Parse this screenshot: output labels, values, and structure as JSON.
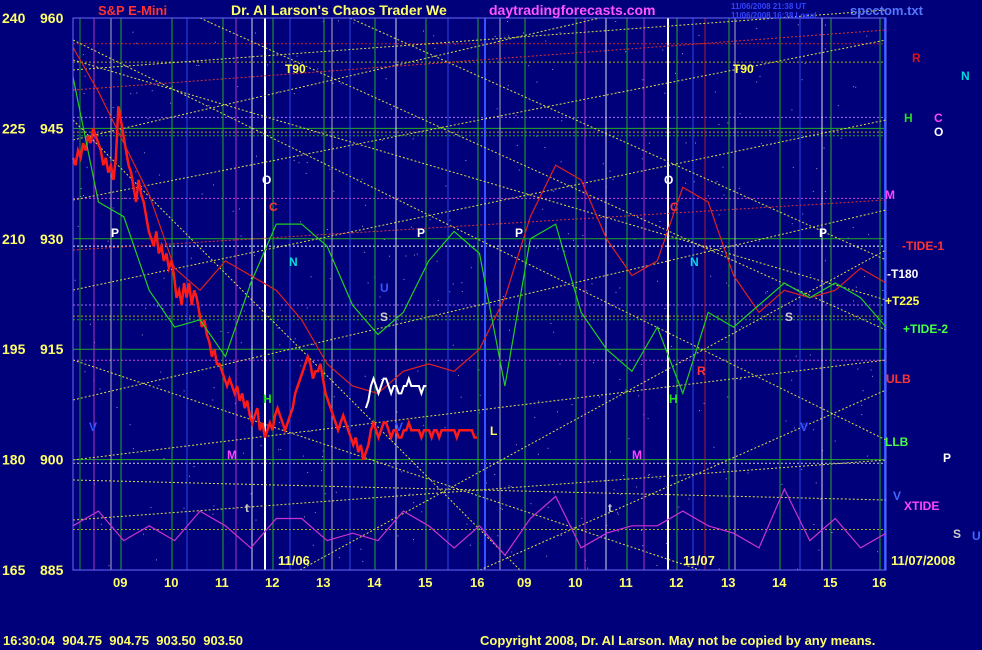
{
  "chart_data": {
    "type": "line",
    "title_left": "S&P E-Mini",
    "title_center": "Dr. Al Larson's Chaos Trader We",
    "title_site": "daytradingforecasts.com",
    "title_file": "spcctom.txt",
    "stamp_line1": "11/06/2008 21:38 UT",
    "stamp_line2": "11/06/2008 16:38 Local",
    "status_bar": "16:30:04  904.75  904.75  903.50  903.50",
    "copyright": "Copyright 2008, Dr. Al Larson. May not be copied by any means.",
    "price_axis": {
      "ticks": [
        885,
        900,
        915,
        930,
        945,
        960
      ],
      "range": [
        885,
        960
      ]
    },
    "secondary_axis": {
      "ticks": [
        165,
        180,
        195,
        210,
        225,
        240
      ],
      "range": [
        165,
        240
      ]
    },
    "x_axis": {
      "tick_labels": [
        "09",
        "10",
        "11",
        "12",
        "13",
        "14",
        "15",
        "16",
        "09",
        "10",
        "11",
        "12",
        "13",
        "14",
        "15",
        "16"
      ],
      "date_labels": [
        "11/06",
        "11/07",
        "11/07/2008"
      ]
    },
    "right_labels": [
      {
        "text": "R",
        "color": "#dd1111"
      },
      {
        "text": "N",
        "color": "#00dddd"
      },
      {
        "text": "H",
        "color": "#22dd22"
      },
      {
        "text": "C",
        "color": "#ff44ff"
      },
      {
        "text": "O",
        "color": "#ffffff"
      },
      {
        "text": "M",
        "color": "#ff44ff"
      },
      {
        "text": "-TIDE-1",
        "color": "#ff3333"
      },
      {
        "text": "-T180",
        "color": "#ffffff"
      },
      {
        "text": "+T225",
        "color": "#ffff44"
      },
      {
        "text": "+TIDE-2",
        "color": "#44ff44"
      },
      {
        "text": "ULB",
        "color": "#ff3333"
      },
      {
        "text": "LLB",
        "color": "#44ff44"
      },
      {
        "text": "P",
        "color": "#ffffff"
      },
      {
        "text": "V",
        "color": "#4466ff"
      },
      {
        "text": "XTIDE",
        "color": "#ff44ff"
      },
      {
        "text": "S",
        "color": "#cccccc"
      },
      {
        "text": "U",
        "color": "#4466ff"
      }
    ],
    "planet_labels": [
      "T90",
      "T90",
      "O",
      "O",
      "C",
      "C",
      "P",
      "P",
      "P",
      "P",
      "N",
      "N",
      "U",
      "S",
      "S",
      "H",
      "H",
      "R",
      "M",
      "M",
      "V",
      "V",
      "V",
      "t",
      "t",
      "L"
    ],
    "series": [
      {
        "name": "S&P E-Mini",
        "color": "#ff1a1a",
        "x": [
          0,
          0.25,
          0.5,
          0.75,
          1,
          1.25,
          1.5,
          1.75,
          2,
          2.25,
          2.5,
          2.75,
          3,
          3.25,
          3.5,
          3.75,
          4,
          4.25,
          4.5,
          4.75,
          5,
          5.25,
          5.5,
          5.75,
          6,
          6.25,
          6.5,
          6.75,
          7,
          7.25,
          7.5,
          7.75,
          8,
          8.25,
          8.5,
          8.75,
          9,
          9.25,
          9.5,
          9.75,
          10,
          10.25,
          10.5,
          10.75,
          11,
          11.25,
          11.5,
          11.75,
          12,
          12.25,
          12.5,
          12.75,
          13,
          13.25,
          13.5,
          13.75,
          14,
          14.25,
          14.5,
          14.75,
          15,
          15.25,
          15.5,
          15.75,
          16,
          16.25,
          16.5,
          16.75,
          17,
          17.25,
          17.5,
          17.75,
          18,
          18.25,
          18.5,
          18.75,
          19,
          19.25,
          19.5,
          19.75,
          20,
          20.25,
          20.5,
          20.75,
          21,
          21.25,
          21.5,
          21.75,
          22,
          22.25,
          22.5,
          22.75,
          23,
          23.25,
          23.5,
          23.75,
          24,
          24.25,
          24.5,
          24.75,
          25,
          25.25,
          25.5,
          25.75,
          26,
          26.25,
          26.5,
          26.75,
          27,
          27.25,
          27.5,
          27.75,
          28,
          28.25,
          28.5,
          28.75,
          29,
          29.25,
          29.5,
          29.75,
          30,
          30.25,
          30.5,
          30.75,
          31,
          31.25,
          31.5,
          31.75,
          32,
          32.25,
          32.5,
          32.75,
          33,
          33.25,
          33.5,
          33.75,
          34,
          34.25,
          34.5,
          34.75,
          35,
          35.25,
          35.5,
          35.75,
          36,
          36.25,
          36.5,
          36.75,
          37,
          37.25,
          37.5,
          37.75,
          38,
          38.25,
          38.5,
          38.75,
          39,
          39.25,
          39.5,
          39.75,
          40
        ],
        "y": [
          941,
          940,
          942,
          941,
          943,
          942,
          944,
          943,
          945,
          944,
          943,
          942,
          940,
          941,
          939,
          940,
          938,
          941,
          948,
          946,
          944,
          942,
          940,
          939,
          937,
          935,
          938,
          936,
          935,
          933,
          931,
          930,
          929,
          931,
          928,
          929,
          927,
          928,
          926,
          927,
          925,
          922,
          923,
          921,
          924,
          922,
          924,
          921,
          923,
          922,
          920,
          918,
          919,
          917,
          916,
          914,
          915,
          913,
          913,
          912,
          911,
          910,
          911,
          910,
          909,
          910,
          908,
          909,
          907,
          908,
          906,
          905,
          906,
          907,
          904,
          905,
          903,
          904,
          905,
          904,
          906,
          907,
          906,
          905,
          904,
          905,
          906,
          907,
          909,
          910,
          911,
          912,
          913,
          914,
          913,
          911,
          912,
          912,
          913,
          911,
          909,
          908,
          907,
          906,
          905,
          904,
          905,
          906,
          905,
          904,
          903,
          902,
          903,
          901,
          902,
          900,
          901,
          902,
          904,
          905,
          904,
          903,
          904,
          905,
          905,
          904,
          903,
          904,
          904,
          903,
          903,
          904,
          904,
          905,
          904,
          904,
          904,
          904,
          903,
          904,
          904,
          904,
          903,
          904,
          904,
          903,
          904,
          904,
          904,
          904,
          904,
          904,
          903,
          904,
          904,
          904,
          904,
          904,
          904,
          903,
          903
        ]
      },
      {
        "name": "-TIDE-1",
        "color": "#e02020",
        "x": [
          0,
          1,
          2,
          3,
          4,
          5,
          6,
          7,
          8,
          9,
          10,
          11,
          12,
          13,
          14,
          15,
          16,
          17,
          18,
          19,
          20,
          21,
          22,
          23,
          24,
          25,
          26,
          27,
          28,
          29,
          30,
          31,
          32
        ],
        "y": [
          956,
          950,
          943,
          936,
          926,
          923,
          927,
          925,
          923,
          919,
          913,
          910,
          909,
          912,
          913,
          912,
          915,
          922,
          933,
          940,
          938,
          930,
          925,
          927,
          937,
          935,
          925,
          920,
          923,
          922,
          923,
          926,
          924
        ]
      },
      {
        "name": "+TIDE-2",
        "color": "#22cc22",
        "x": [
          0,
          1,
          2,
          3,
          4,
          5,
          6,
          7,
          8,
          9,
          10,
          11,
          12,
          13,
          14,
          15,
          16,
          17,
          18,
          19,
          20,
          21,
          22,
          23,
          24,
          25,
          26,
          27,
          28,
          29,
          30,
          31,
          32
        ],
        "y": [
          952,
          935,
          933,
          923,
          918,
          919,
          914,
          924,
          932,
          932,
          929,
          921,
          917,
          920,
          927,
          931,
          928,
          910,
          930,
          932,
          920,
          915,
          912,
          918,
          909,
          920,
          918,
          921,
          924,
          922,
          924,
          922,
          918
        ]
      },
      {
        "name": "XTIDE",
        "color": "#cc33cc",
        "x": [
          0,
          1,
          2,
          3,
          4,
          5,
          6,
          7,
          8,
          9,
          10,
          11,
          12,
          13,
          14,
          15,
          16,
          17,
          18,
          19,
          20,
          21,
          22,
          23,
          24,
          25,
          26,
          27,
          28,
          29,
          30,
          31,
          32
        ],
        "y": [
          891,
          893,
          889,
          891,
          889,
          893,
          891,
          888,
          892,
          892,
          889,
          890,
          889,
          893,
          891,
          888,
          891,
          887,
          892,
          895,
          888,
          890,
          891,
          891,
          893,
          891,
          890,
          888,
          896,
          889,
          892,
          888,
          890
        ]
      }
    ]
  }
}
